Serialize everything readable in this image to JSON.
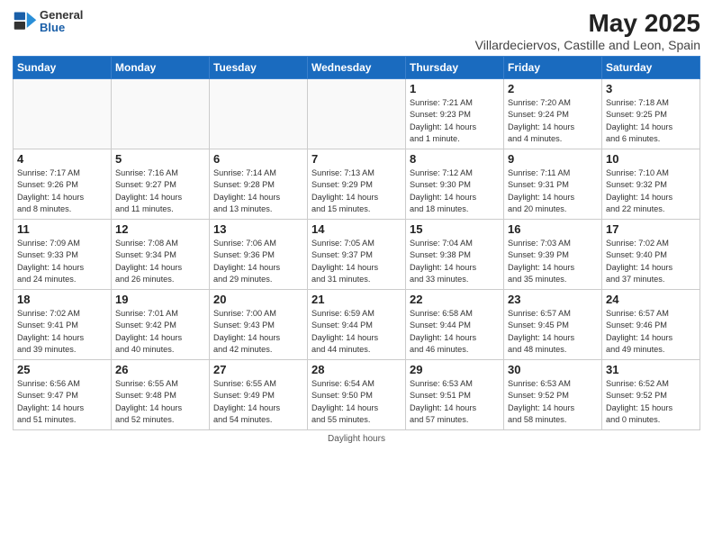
{
  "header": {
    "logo_line1": "General",
    "logo_line2": "Blue",
    "title": "May 2025",
    "subtitle": "Villardeciervos, Castille and Leon, Spain"
  },
  "days_of_week": [
    "Sunday",
    "Monday",
    "Tuesday",
    "Wednesday",
    "Thursday",
    "Friday",
    "Saturday"
  ],
  "footer": "Daylight hours",
  "weeks": [
    [
      {
        "num": "",
        "info": ""
      },
      {
        "num": "",
        "info": ""
      },
      {
        "num": "",
        "info": ""
      },
      {
        "num": "",
        "info": ""
      },
      {
        "num": "1",
        "info": "Sunrise: 7:21 AM\nSunset: 9:23 PM\nDaylight: 14 hours\nand 1 minute."
      },
      {
        "num": "2",
        "info": "Sunrise: 7:20 AM\nSunset: 9:24 PM\nDaylight: 14 hours\nand 4 minutes."
      },
      {
        "num": "3",
        "info": "Sunrise: 7:18 AM\nSunset: 9:25 PM\nDaylight: 14 hours\nand 6 minutes."
      }
    ],
    [
      {
        "num": "4",
        "info": "Sunrise: 7:17 AM\nSunset: 9:26 PM\nDaylight: 14 hours\nand 8 minutes."
      },
      {
        "num": "5",
        "info": "Sunrise: 7:16 AM\nSunset: 9:27 PM\nDaylight: 14 hours\nand 11 minutes."
      },
      {
        "num": "6",
        "info": "Sunrise: 7:14 AM\nSunset: 9:28 PM\nDaylight: 14 hours\nand 13 minutes."
      },
      {
        "num": "7",
        "info": "Sunrise: 7:13 AM\nSunset: 9:29 PM\nDaylight: 14 hours\nand 15 minutes."
      },
      {
        "num": "8",
        "info": "Sunrise: 7:12 AM\nSunset: 9:30 PM\nDaylight: 14 hours\nand 18 minutes."
      },
      {
        "num": "9",
        "info": "Sunrise: 7:11 AM\nSunset: 9:31 PM\nDaylight: 14 hours\nand 20 minutes."
      },
      {
        "num": "10",
        "info": "Sunrise: 7:10 AM\nSunset: 9:32 PM\nDaylight: 14 hours\nand 22 minutes."
      }
    ],
    [
      {
        "num": "11",
        "info": "Sunrise: 7:09 AM\nSunset: 9:33 PM\nDaylight: 14 hours\nand 24 minutes."
      },
      {
        "num": "12",
        "info": "Sunrise: 7:08 AM\nSunset: 9:34 PM\nDaylight: 14 hours\nand 26 minutes."
      },
      {
        "num": "13",
        "info": "Sunrise: 7:06 AM\nSunset: 9:36 PM\nDaylight: 14 hours\nand 29 minutes."
      },
      {
        "num": "14",
        "info": "Sunrise: 7:05 AM\nSunset: 9:37 PM\nDaylight: 14 hours\nand 31 minutes."
      },
      {
        "num": "15",
        "info": "Sunrise: 7:04 AM\nSunset: 9:38 PM\nDaylight: 14 hours\nand 33 minutes."
      },
      {
        "num": "16",
        "info": "Sunrise: 7:03 AM\nSunset: 9:39 PM\nDaylight: 14 hours\nand 35 minutes."
      },
      {
        "num": "17",
        "info": "Sunrise: 7:02 AM\nSunset: 9:40 PM\nDaylight: 14 hours\nand 37 minutes."
      }
    ],
    [
      {
        "num": "18",
        "info": "Sunrise: 7:02 AM\nSunset: 9:41 PM\nDaylight: 14 hours\nand 39 minutes."
      },
      {
        "num": "19",
        "info": "Sunrise: 7:01 AM\nSunset: 9:42 PM\nDaylight: 14 hours\nand 40 minutes."
      },
      {
        "num": "20",
        "info": "Sunrise: 7:00 AM\nSunset: 9:43 PM\nDaylight: 14 hours\nand 42 minutes."
      },
      {
        "num": "21",
        "info": "Sunrise: 6:59 AM\nSunset: 9:44 PM\nDaylight: 14 hours\nand 44 minutes."
      },
      {
        "num": "22",
        "info": "Sunrise: 6:58 AM\nSunset: 9:44 PM\nDaylight: 14 hours\nand 46 minutes."
      },
      {
        "num": "23",
        "info": "Sunrise: 6:57 AM\nSunset: 9:45 PM\nDaylight: 14 hours\nand 48 minutes."
      },
      {
        "num": "24",
        "info": "Sunrise: 6:57 AM\nSunset: 9:46 PM\nDaylight: 14 hours\nand 49 minutes."
      }
    ],
    [
      {
        "num": "25",
        "info": "Sunrise: 6:56 AM\nSunset: 9:47 PM\nDaylight: 14 hours\nand 51 minutes."
      },
      {
        "num": "26",
        "info": "Sunrise: 6:55 AM\nSunset: 9:48 PM\nDaylight: 14 hours\nand 52 minutes."
      },
      {
        "num": "27",
        "info": "Sunrise: 6:55 AM\nSunset: 9:49 PM\nDaylight: 14 hours\nand 54 minutes."
      },
      {
        "num": "28",
        "info": "Sunrise: 6:54 AM\nSunset: 9:50 PM\nDaylight: 14 hours\nand 55 minutes."
      },
      {
        "num": "29",
        "info": "Sunrise: 6:53 AM\nSunset: 9:51 PM\nDaylight: 14 hours\nand 57 minutes."
      },
      {
        "num": "30",
        "info": "Sunrise: 6:53 AM\nSunset: 9:52 PM\nDaylight: 14 hours\nand 58 minutes."
      },
      {
        "num": "31",
        "info": "Sunrise: 6:52 AM\nSunset: 9:52 PM\nDaylight: 15 hours\nand 0 minutes."
      }
    ]
  ]
}
